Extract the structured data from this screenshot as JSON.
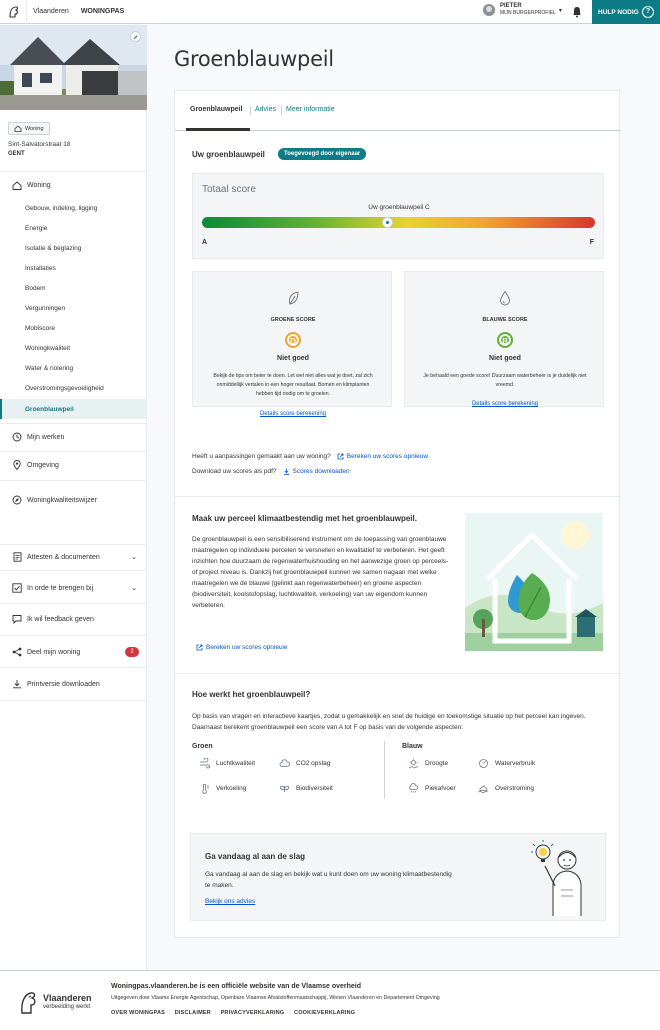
{
  "topbar": {
    "brand": "Vlaanderen",
    "app": "WONINGPAS",
    "user_name": "PIETER",
    "user_sub": "MIJN BURGERPROFIEL",
    "help": "HULP NODIG",
    "help_icon": "?"
  },
  "sidebar": {
    "tag": "Woning",
    "address_line1": "Sint-Salvatorstraat 18",
    "address_line2": "GENT",
    "woning_label": "Woning",
    "sub_items": [
      "Gebouw, indeling, ligging",
      "Energie",
      "Isolatie & beglazing",
      "Installaties",
      "Bodem",
      "Vergunningen",
      "Mobiscore",
      "Woningkwaliteit",
      "Water & riolering",
      "Overstromingsgevoeligheid",
      "Groenblauwpeil"
    ],
    "main_items": {
      "mijn_werken": "Mijn werken",
      "omgeving": "Omgeving",
      "wijzer": "Woningkwaliteitswijzer",
      "attesten": "Attesten & documenten",
      "in_orde": "In orde te brengen bij",
      "feedback": "Ik wil feedback geven",
      "deel": "Deel mijn woning",
      "deel_badge": "2",
      "print": "Printversie downloaden"
    }
  },
  "page": {
    "title": "Groenblauwpeil",
    "tabs": [
      "Groenblauwpeil",
      "Advies",
      "Meer informatie"
    ]
  },
  "score": {
    "section_title": "Uw groenblauwpeil",
    "pill": "Toegevoegd door eigenaar",
    "total_label": "Totaal score",
    "current_label": "Uw groenblauwpeil C",
    "position_fraction": 0.47,
    "scale_start": "A",
    "scale_end": "F",
    "green": {
      "title": "GROENE SCORE",
      "letter": "D",
      "color": "#f0a532",
      "verdict": "Niet goed",
      "desc": "Bekijk de tips om beter te doen. Let wel niet alles wat je doet, zal zich onmiddellijk vertalen in een hoger resultaat. Bomen en klimplanten hebben tijd nodig om te groeien.",
      "link": "Details score berekening"
    },
    "blue": {
      "title": "BLAUWE SCORE",
      "letter": "B",
      "color": "#5fb136",
      "verdict": "Niet goed",
      "desc": "Je behaald een goede score! Duurzaam waterbeheer is je duidelijk niet vreemd.",
      "link": "Details score berekening"
    },
    "recalc_q": "Heeft u aanpassingen gemaakt aan uw woning?",
    "recalc_link": "Bereken uw scores opnieuw",
    "download_q": "Download uw scores als pdf?",
    "download_link": "Scores downloaden"
  },
  "klimaat": {
    "title": "Maak uw perceel klimaatbestendig met het groenblauwpeil.",
    "body": "De groenblauwpeil is een sensibiliserend instrument om de toepassing van groenblauwe maatregelen op individuele percelen te versnellen en kwalitatief te verbeteren. Het geeft inzichten hoe duurzaam de regenwaterhuishouding en het aanwezige groen op perceels- of project niveau is.  Dankzij het groenblauwpeil kunnen we samen nagaan met welke maatregelen we de blauwe (gelinkt aan regenwaterbeheer) en groene aspecten (biodiversiteit, koolstofopslag, luchtkwaliteit, verkoeling) van uw eigendom kunnen verbeteren.",
    "link": "Bereken uw scores opnieuw"
  },
  "hoe": {
    "title": "Hoe werkt het groenblauwpeil?",
    "body": "Op basis van vragen en interactieve kaartjes, zodat u gemakkelijk en snel de huidige en toekomstige situatie op het perceel kan ingeven. Daarnaast berekent groenblauwpeil een score van A tot F op basis van de volgende aspecten:",
    "groen_title": "Groen",
    "groen": [
      "Luchtkwaliteit",
      "CO2 opslag",
      "Verkoeling",
      "Biodiversiteit"
    ],
    "blauw_title": "Blauw",
    "blauw": [
      "Droogte",
      "Waterverbruik",
      "Piekafvoer",
      "Overstroming"
    ]
  },
  "cta": {
    "title": "Ga vandaag al aan de slag",
    "body": "Ga vandaag al aan de slag en bekijk wat u kunt doen om uw woning klimaatbestendig te maken.",
    "link": "Bekijk ons advies"
  },
  "footer": {
    "logo_main": "Vlaanderen",
    "logo_sub": "verbeelding werkt",
    "title": "Woningpas.vlaanderen.be is een officiële website van de Vlaamse overheid",
    "sub": "Uitgegeven door Vlaams Energie Agentschap, Openbare Vlaamse Afvalstoffenmaatschappij, Wonen Vlaanderen en Departement Omgeving",
    "links": [
      "OVER WONINGPAS",
      "DISCLAIMER",
      "PRIVACYVERKLARING",
      "COOKIEVERKLARING"
    ]
  },
  "colors": {
    "accent": "#0e7c86",
    "link": "#0055cc",
    "badge": "#d2373c"
  }
}
